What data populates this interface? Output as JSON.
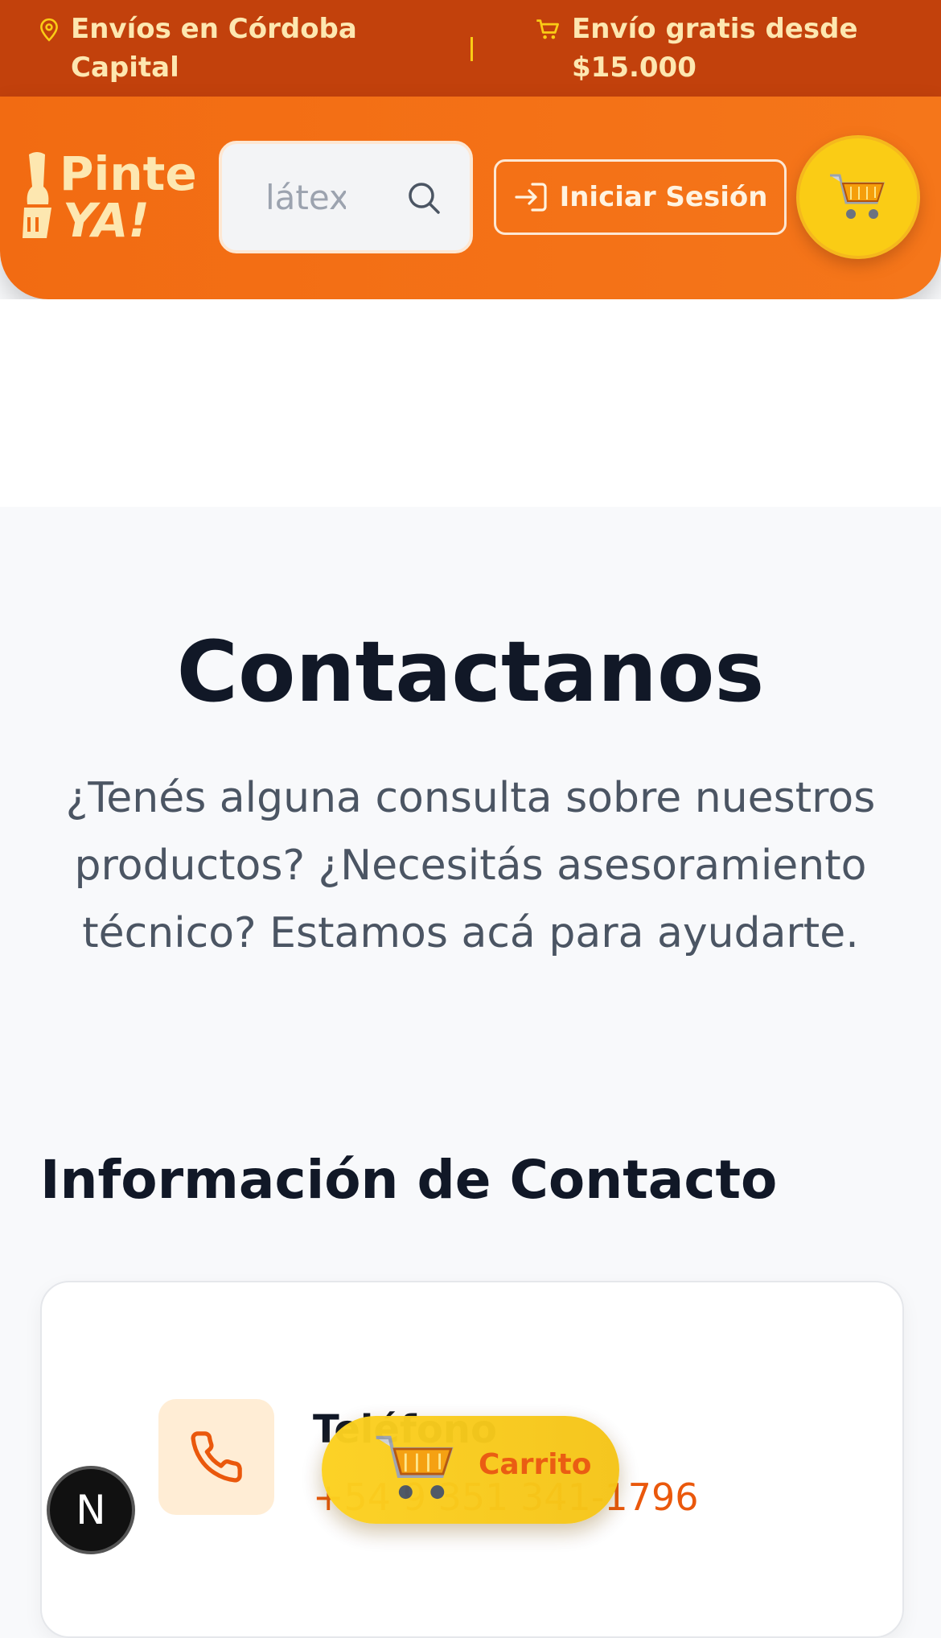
{
  "topbar": {
    "location_line1": "Envíos en Córdoba",
    "location_line2": "Capital",
    "shipping_line1": "Envío gratis desde",
    "shipping_line2": "$15.000",
    "location_icon": "map-pin-icon",
    "shipping_icon": "cart-icon"
  },
  "header": {
    "logo_line1": "Pinte",
    "logo_line2": "YA!",
    "search_placeholder": "látex",
    "login_label": "Iniciar Sesión",
    "login_icon": "login-arrow-icon",
    "cart_icon": "shopping-cart-icon"
  },
  "hero": {
    "title": "Contactanos",
    "subtitle": "¿Tenés alguna consulta sobre nuestros productos? ¿Necesitás asesoramiento técnico? Estamos acá para ayudarte."
  },
  "contact": {
    "heading": "Información de Contacto",
    "phone_label": "Teléfono",
    "phone_value": "+54 9 351 341-1796",
    "phone_icon": "phone-icon"
  },
  "floating_cart": {
    "label": "Carrito"
  },
  "dev_badge": {
    "letter": "N"
  },
  "colors": {
    "top_bar": "#c2410c",
    "header": "#f26b12",
    "accent_yellow": "#facc15",
    "link_orange": "#ea580c"
  }
}
